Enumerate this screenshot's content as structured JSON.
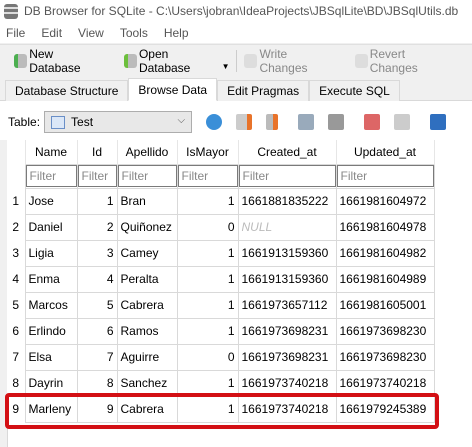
{
  "window": {
    "title": "DB Browser for SQLite - C:\\Users\\jobran\\IdeaProjects\\JBSqlLite\\BD\\JBSqlUtils.db"
  },
  "menu": [
    "File",
    "Edit",
    "View",
    "Tools",
    "Help"
  ],
  "toolbar": {
    "new_db": "New Database",
    "open_db": "Open Database",
    "write": "Write Changes",
    "revert": "Revert Changes"
  },
  "tabs": [
    "Database Structure",
    "Browse Data",
    "Edit Pragmas",
    "Execute SQL"
  ],
  "browse": {
    "table_label": "Table:",
    "table_value": "Test"
  },
  "grid": {
    "columns": [
      "Name",
      "Id",
      "Apellido",
      "IsMayor",
      "Created_at",
      "Updated_at"
    ],
    "filter_placeholder": "Filter",
    "rows": [
      [
        "1",
        "Jose",
        "1",
        "Bran",
        "1",
        "1661881835222",
        "1661981604972"
      ],
      [
        "2",
        "Daniel",
        "2",
        "Quiñonez",
        "0",
        "NULL",
        "1661981604978"
      ],
      [
        "3",
        "Ligia",
        "3",
        "Camey",
        "1",
        "1661913159360",
        "1661981604982"
      ],
      [
        "4",
        "Enma",
        "4",
        "Peralta",
        "1",
        "1661913159360",
        "1661981604989"
      ],
      [
        "5",
        "Marcos",
        "5",
        "Cabrera",
        "1",
        "1661973657112",
        "1661981605001"
      ],
      [
        "6",
        "Erlindo",
        "6",
        "Ramos",
        "1",
        "1661973698231",
        "1661973698230"
      ],
      [
        "7",
        "Elsa",
        "7",
        "Aguirre",
        "0",
        "1661973698231",
        "1661973698230"
      ],
      [
        "8",
        "Dayrin",
        "8",
        "Sanchez",
        "1",
        "1661973740218",
        "1661973740218"
      ],
      [
        "9",
        "Marleny",
        "9",
        "Cabrera",
        "1",
        "1661973740218",
        "1661979245389"
      ]
    ]
  },
  "highlight_color": "#d30f14"
}
